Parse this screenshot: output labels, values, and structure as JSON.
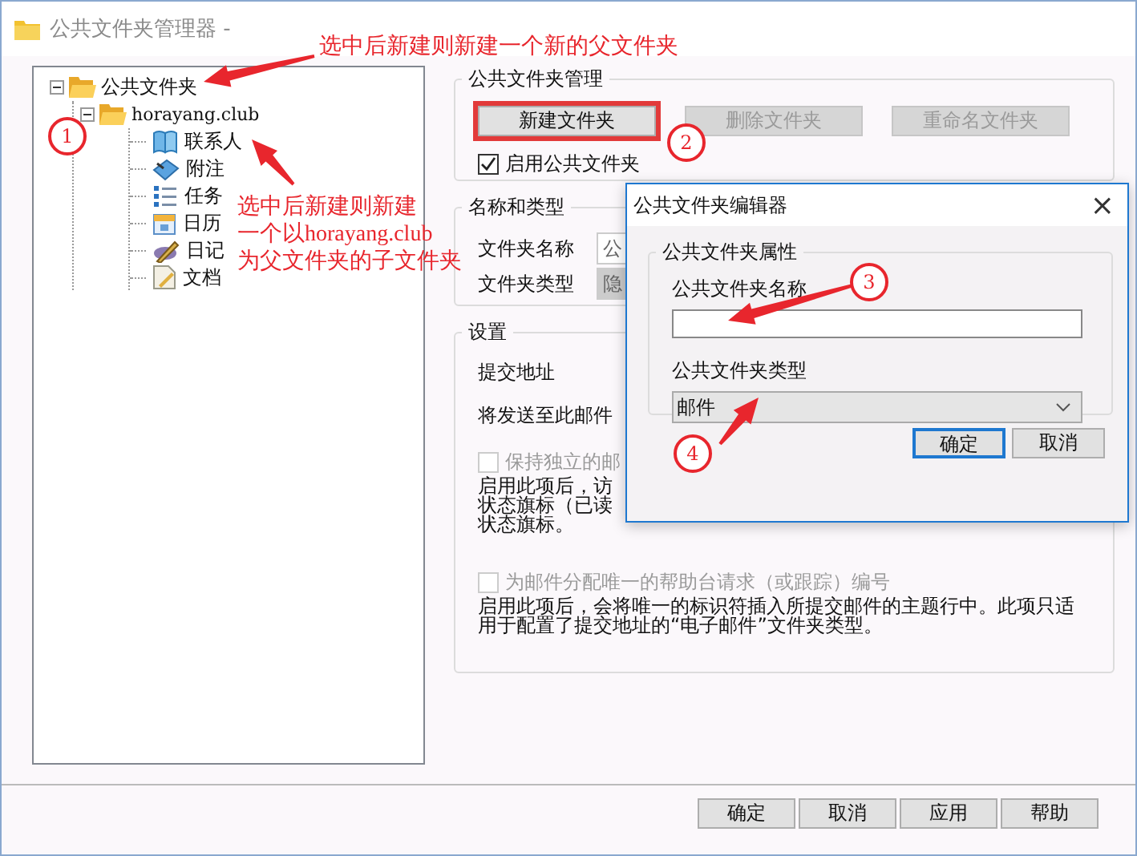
{
  "window": {
    "title": "公共文件夹管理器 -"
  },
  "tree": [
    {
      "label": "公共文件夹",
      "expanded": true,
      "children": [
        {
          "label": "horayang.club",
          "expanded": true,
          "children": [
            {
              "label": "联系人",
              "kind": "contacts"
            },
            {
              "label": "附注",
              "kind": "notes"
            },
            {
              "label": "任务",
              "kind": "tasks"
            },
            {
              "label": "日历",
              "kind": "calendar"
            },
            {
              "label": "日记",
              "kind": "journal"
            },
            {
              "label": "文档",
              "kind": "documents"
            }
          ]
        }
      ]
    }
  ],
  "management": {
    "title": "公共文件夹管理",
    "buttons": [
      {
        "label": "新建文件夹",
        "disabled": false,
        "highlighted": true
      },
      {
        "label": "删除文件夹",
        "disabled": true,
        "highlighted": false
      },
      {
        "label": "重命名文件夹",
        "disabled": true,
        "highlighted": false
      }
    ],
    "enable": {
      "label": "启用公共文件夹",
      "checked": true
    }
  },
  "name_type": {
    "title": "名称和类型",
    "fields": [
      {
        "label": "文件夹名称",
        "value": "公",
        "disabled": false
      },
      {
        "label": "文件夹类型",
        "value": "隐",
        "disabled": true
      }
    ]
  },
  "settings": {
    "title": "设置",
    "submit_label": "提交地址",
    "submit_hint": "将发送至此邮件",
    "options": [
      {
        "label": "保持独立的邮",
        "checked": false,
        "disabled": true,
        "description": [
          "启用此项后，访",
          "状态旗标（已读",
          "状态旗标。"
        ]
      },
      {
        "label": "为邮件分配唯一的帮助台请求（或跟踪）编号",
        "checked": false,
        "disabled": true,
        "description": [
          "启用此项后，会将唯一的标识符插入所提交邮件的主题行中。此项只适",
          "用于配置了提交地址的“电子邮件”文件夹类型。"
        ]
      }
    ]
  },
  "footer_buttons": [
    "确定",
    "取消",
    "应用",
    "帮助"
  ],
  "dialog": {
    "title": "公共文件夹编辑器",
    "close": "×",
    "group": "公共文件夹属性",
    "name_label": "公共文件夹名称",
    "type_label": "公共文件夹类型",
    "type_value": "邮件",
    "buttons": [
      {
        "label": "确定",
        "default": true
      },
      {
        "label": "取消",
        "default": false
      }
    ]
  },
  "annotations": {
    "callouts": [
      {
        "lines": [
          "选中后新建则新建一个新的父文件夹"
        ]
      },
      {
        "lines": [
          "选中后新建则新建",
          "一个以horayang.club",
          "为父文件夹的子文件夹"
        ]
      }
    ],
    "markers": [
      "1",
      "2",
      "3",
      "4"
    ]
  }
}
